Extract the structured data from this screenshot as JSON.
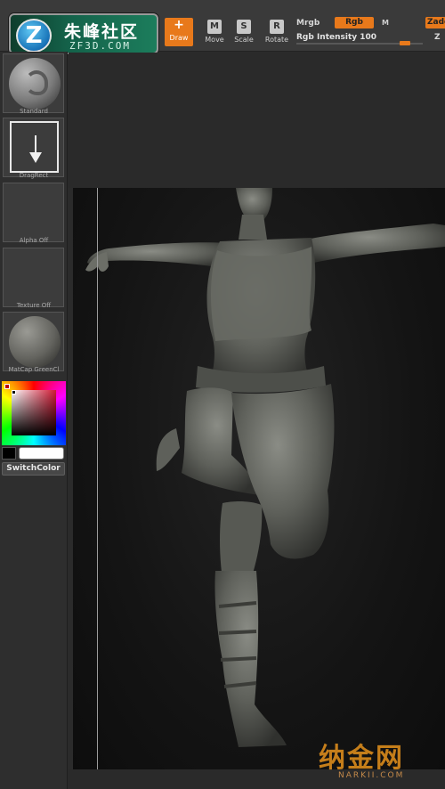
{
  "logo": {
    "badge": "Z",
    "title": "朱峰社区",
    "subtitle": "ZF3D.COM"
  },
  "toolbar": {
    "tools": [
      {
        "id": "draw",
        "label": "Draw",
        "icon": "draw-icon",
        "glyph": "+",
        "active": true
      },
      {
        "id": "move",
        "label": "Move",
        "icon": "move-icon",
        "glyph": "M"
      },
      {
        "id": "scale",
        "label": "Scale",
        "icon": "scale-icon",
        "glyph": "S"
      },
      {
        "id": "rotate",
        "label": "Rotate",
        "icon": "rotate-icon",
        "glyph": "R"
      }
    ],
    "mrgb_label": "Mrgb",
    "rgb_label": "Rgb",
    "m_label": "M",
    "zadd_label": "Zadd",
    "rgb_intensity_label": "Rgb  Intensity 100",
    "rgb_intensity_value": 100,
    "z_label": "Z",
    "accent_color": "#e8791b"
  },
  "shelf": {
    "brush": {
      "label": "Standard",
      "icon": "standard-brush-icon"
    },
    "stroke": {
      "label": "DragRect",
      "icon": "dragrect-stroke-icon"
    },
    "alpha": {
      "label": "Alpha  Off"
    },
    "texture": {
      "label": "Texture  Off"
    },
    "material": {
      "label": "MatCap  GreenCl",
      "icon": "matcap-sphere-icon"
    },
    "color": {
      "main": "#000000",
      "secondary": "#ffffff"
    },
    "switch_color_label": "SwitchColor"
  },
  "watermark": {
    "text": "纳金网",
    "url": "NARKII.COM"
  }
}
